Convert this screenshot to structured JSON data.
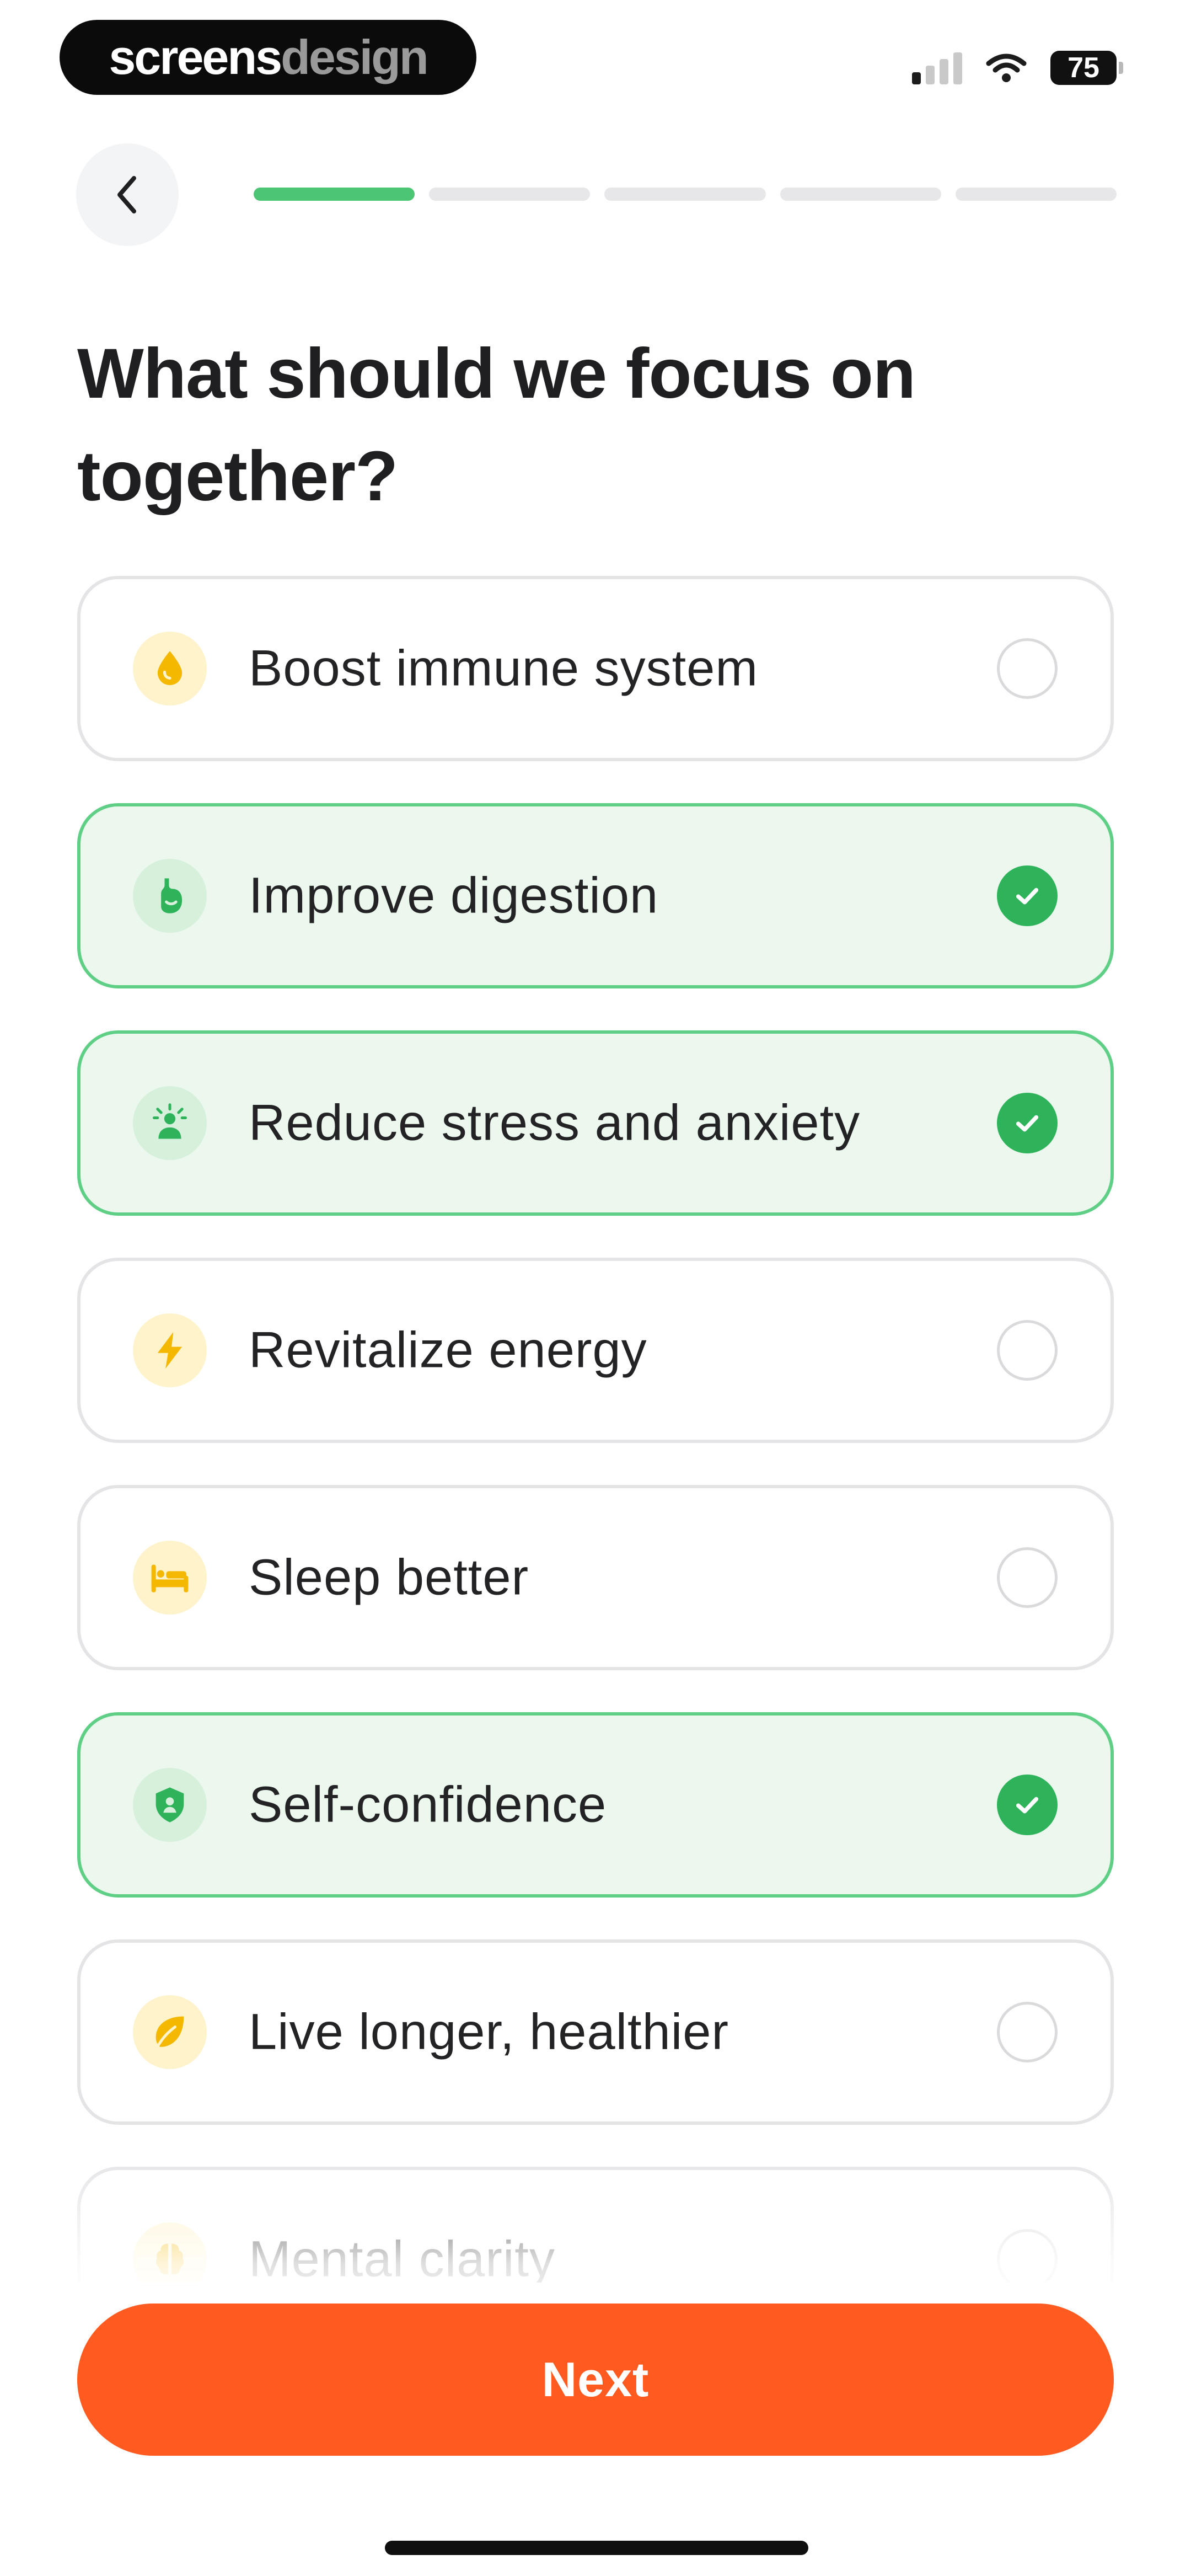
{
  "status_bar": {
    "brand_part1": "screens",
    "brand_part2": "design",
    "battery_level": "75",
    "signal_bars_active": 1,
    "signal_bars_total": 4
  },
  "header": {
    "back_icon": "chevron-left-icon",
    "progress": {
      "current_step": 1,
      "total_steps": 5
    }
  },
  "title": "What should we focus on together?",
  "options": [
    {
      "label": "Boost immune system",
      "icon": "drop-icon",
      "selected": false
    },
    {
      "label": "Improve digestion",
      "icon": "stomach-icon",
      "selected": true
    },
    {
      "label": "Reduce stress and anxiety",
      "icon": "stress-icon",
      "selected": true
    },
    {
      "label": "Revitalize energy",
      "icon": "lightning-icon",
      "selected": false
    },
    {
      "label": "Sleep better",
      "icon": "bed-icon",
      "selected": false
    },
    {
      "label": "Self-confidence",
      "icon": "shield-person-icon",
      "selected": true
    },
    {
      "label": "Live longer, healthier",
      "icon": "leaf-icon",
      "selected": false
    },
    {
      "label": "Mental clarity",
      "icon": "brain-icon",
      "selected": false
    }
  ],
  "next_button": {
    "label": "Next"
  },
  "colors": {
    "accent_green": "#4cc675",
    "check_green": "#2fb35a",
    "selected_bg": "#ecf8ee",
    "cta_orange": "#ff5a1f",
    "icon_yellow": "#f5b800"
  }
}
